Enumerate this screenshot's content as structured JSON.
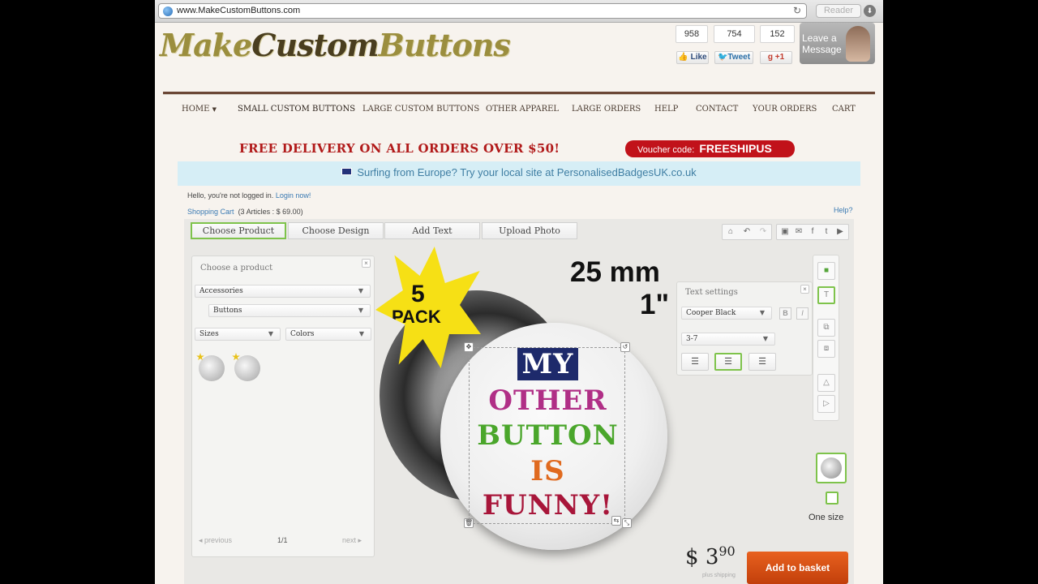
{
  "browser": {
    "url": "www.MakeCustomButtons.com",
    "reader_label": "Reader"
  },
  "header": {
    "logo_a": "Make",
    "logo_b": "Custom",
    "logo_c": "Buttons",
    "counts": [
      "958",
      "754",
      "152"
    ],
    "like": "Like",
    "tweet": "Tweet",
    "plus": "+1",
    "leave": [
      "Leave a",
      "Message"
    ]
  },
  "nav": [
    "HOME",
    "SMALL CUSTOM BUTTONS",
    "LARGE CUSTOM BUTTONS",
    "OTHER APPAREL",
    "LARGE ORDERS",
    "HELP",
    "CONTACT",
    "YOUR ORDERS",
    "CART"
  ],
  "promo": {
    "text": "FREE DELIVERY ON ALL ORDERS OVER $50!",
    "voucher_label": "Voucher code:",
    "voucher_code": "FREESHIPUS"
  },
  "eu_notice": "Surfing from Europe? Try your local site at PersonalisedBadgesUK.co.uk",
  "account": {
    "hello": "Hello, you're not logged in.",
    "login": "Login now!",
    "cart_link": "Shopping Cart",
    "cart_info": "(3 Articles : $ 69.00)",
    "help": "Help?"
  },
  "tabs": [
    "Choose Product",
    "Choose Design",
    "Add Text",
    "Upload Photo"
  ],
  "product_panel": {
    "title": "Choose a product",
    "category": "Accessories",
    "subcategory": "Buttons",
    "sizes": "Sizes",
    "colors": "Colors",
    "prev": "previous",
    "page": "1/1",
    "next": "next"
  },
  "burst": {
    "num": "5",
    "word": "PACK"
  },
  "size": {
    "mm": "25 mm",
    "inch": "1\""
  },
  "button_text": [
    "MY",
    "OTHER",
    "BUTTON",
    "IS",
    "FUNNY!"
  ],
  "text_settings": {
    "title": "Text settings",
    "font": "Cooper Black",
    "size": "3-7",
    "bold": "B",
    "italic": "I"
  },
  "one_size": "One size",
  "price": {
    "currency": "$",
    "main": "3",
    "cents": "90",
    "note": "plus shipping"
  },
  "basket": "Add to basket",
  "colors": {
    "accent_green": "#7ec34b",
    "brand_red": "#c1121a",
    "basket_orange": "#d6511a",
    "line_navy": "#1e2a6b",
    "line_purple": "#b02f86",
    "line_green": "#4aa62b",
    "line_orange": "#e06a1f",
    "line_crimson": "#a8163a"
  }
}
